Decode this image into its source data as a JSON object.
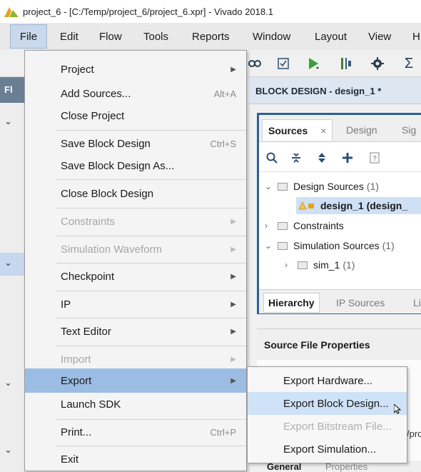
{
  "window": {
    "title": "project_6 - [C:/Temp/project_6/project_6.xpr] - Vivado 2018.1"
  },
  "menubar": {
    "items": [
      "File",
      "Edit",
      "Flow",
      "Tools",
      "Reports",
      "Window",
      "Layout",
      "View",
      "H"
    ],
    "active": "File"
  },
  "toolbar": {
    "icons": [
      "link-icon",
      "checklist-icon",
      "run-icon",
      "program-icon",
      "settings-icon",
      "sigma-icon"
    ]
  },
  "flow_navigator": {
    "header": "Fl"
  },
  "file_menu": {
    "items": [
      {
        "label": "Project",
        "submenu": true
      },
      {
        "label": "Add Sources...",
        "shortcut": "Alt+A"
      },
      {
        "label": "Close Project"
      },
      {
        "label": "Save Block Design",
        "shortcut": "Ctrl+S"
      },
      {
        "label": "Save Block Design As..."
      },
      {
        "label": "Close Block Design"
      },
      {
        "label": "Constraints",
        "submenu": true,
        "disabled": true
      },
      {
        "label": "Simulation Waveform",
        "submenu": true,
        "disabled": true
      },
      {
        "label": "Checkpoint",
        "submenu": true
      },
      {
        "label": "IP",
        "submenu": true
      },
      {
        "label": "Text Editor",
        "submenu": true
      },
      {
        "label": "Import",
        "submenu": true,
        "disabled": true
      },
      {
        "label": "Export",
        "submenu": true,
        "highlighted": true
      },
      {
        "label": "Launch SDK"
      },
      {
        "label": "Print...",
        "shortcut": "Ctrl+P"
      },
      {
        "label": "Exit"
      }
    ]
  },
  "export_submenu": {
    "items": [
      {
        "label": "Export Hardware..."
      },
      {
        "label": "Export Block Design...",
        "highlighted": true
      },
      {
        "label": "Export Bitstream File...",
        "disabled": true
      },
      {
        "label": "Export Simulation..."
      }
    ]
  },
  "block_design": {
    "header": "BLOCK DESIGN - design_1 *"
  },
  "sources": {
    "tabs": [
      "Sources",
      "Design",
      "Sig"
    ],
    "close_glyph": "×",
    "tree": [
      {
        "label": "Design Sources",
        "count": "(1)",
        "expanded": true
      },
      {
        "label": "design_1 (design_",
        "count": "",
        "selected": true
      },
      {
        "label": "Constraints",
        "count": ""
      },
      {
        "label": "Simulation Sources",
        "count": "(1)",
        "expanded": true
      },
      {
        "label": "sim_1",
        "count": "(1)"
      }
    ],
    "bottom_tabs": [
      "Hierarchy",
      "IP Sources",
      "Li"
    ]
  },
  "source_file_properties": {
    "title": "Source File Properties",
    "partial_text": "/pro",
    "tabs": [
      "General",
      "Properties"
    ]
  }
}
